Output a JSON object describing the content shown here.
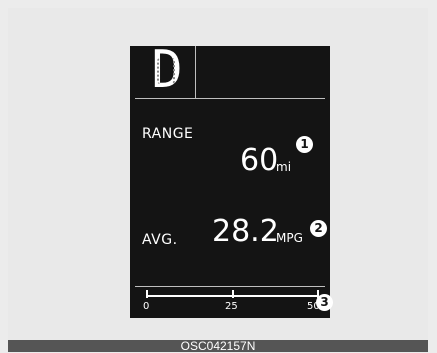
{
  "display": {
    "gear": "D",
    "range": {
      "label": "RANGE",
      "value": "60",
      "unit": "mi",
      "callout": "1"
    },
    "avg": {
      "label": "AVG.",
      "value": "28.2",
      "unit": "MPG",
      "callout": "2"
    },
    "scale": {
      "ticks": [
        "0",
        "25",
        "50"
      ],
      "callout": "3"
    }
  },
  "footer": {
    "code": "OSC042157N"
  },
  "colors": {
    "screen_bg": "#141414",
    "text": "#ffffff",
    "divider": "#bfbfbf",
    "page_bg": "#ececec"
  }
}
